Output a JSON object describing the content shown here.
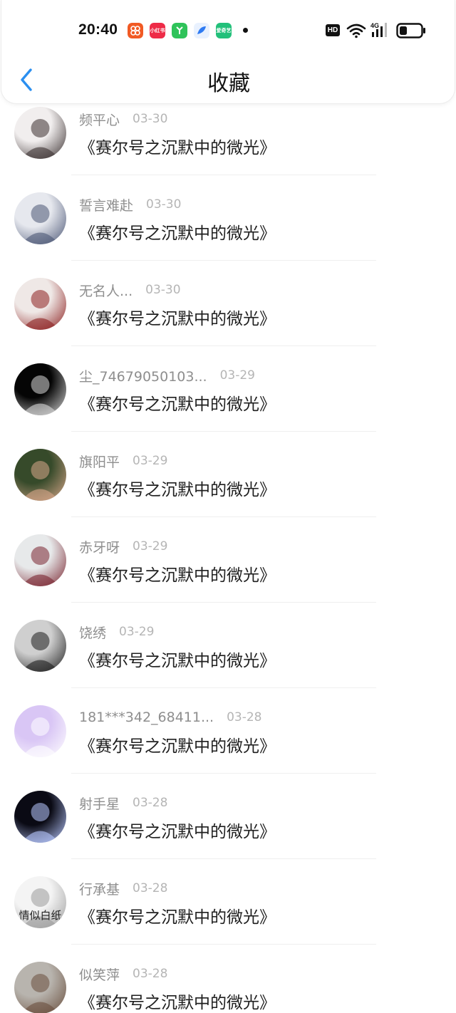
{
  "status_bar": {
    "time": "20:40",
    "apps": [
      {
        "icon": "app-orange-icon",
        "color": "#f15a24",
        "label": ""
      },
      {
        "icon": "xiaohongshu-icon",
        "color": "#ee2b47",
        "label": "小红书"
      },
      {
        "icon": "app-green-icon",
        "color": "#2fc35a",
        "label": ""
      },
      {
        "icon": "app-blue-icon",
        "color": "#2f7bf2",
        "label": ""
      },
      {
        "icon": "iqiyi-icon",
        "color": "#22c07a",
        "label": "爱奇艺"
      }
    ],
    "hd_label": "HD",
    "network_label": "4G",
    "battery_level": 0.35
  },
  "nav": {
    "back_icon": "chevron-left-icon",
    "title": "收藏",
    "accent_color": "#2a8ff0"
  },
  "items": [
    {
      "username": "频平心",
      "date": "03-30",
      "title": "《赛尔号之沉默中的微光》",
      "avatar_colors": [
        "#f1eeee",
        "#3a3030"
      ]
    },
    {
      "username": "誓言难赴",
      "date": "03-30",
      "title": "《赛尔号之沉默中的微光》",
      "avatar_colors": [
        "#e6e8ee",
        "#4b5675"
      ]
    },
    {
      "username": "无名人...",
      "date": "03-30",
      "title": "《赛尔号之沉默中的微光》",
      "avatar_colors": [
        "#efe8e6",
        "#8c1f1f"
      ]
    },
    {
      "username": "尘_74679050103...",
      "date": "03-29",
      "title": "《赛尔号之沉默中的微光》",
      "avatar_colors": [
        "#050505",
        "#d9d9d9"
      ]
    },
    {
      "username": "旗阳平",
      "date": "03-29",
      "title": "《赛尔号之沉默中的微光》",
      "avatar_colors": [
        "#364a2a",
        "#d8a78a"
      ]
    },
    {
      "username": "赤牙呀",
      "date": "03-29",
      "title": "《赛尔号之沉默中的微光》",
      "avatar_colors": [
        "#e7e9ea",
        "#7a2530"
      ]
    },
    {
      "username": "饶绣",
      "date": "03-29",
      "title": "《赛尔号之沉默中的微光》",
      "avatar_colors": [
        "#cfcfcf",
        "#1e1e1e"
      ]
    },
    {
      "username": "181***342_68411...",
      "date": "03-28",
      "title": "《赛尔号之沉默中的微光》",
      "avatar_colors": [
        "#d9c6f5",
        "#ffffff"
      ]
    },
    {
      "username": "射手星",
      "date": "03-28",
      "title": "《赛尔号之沉默中的微光》",
      "avatar_colors": [
        "#0a0a14",
        "#b8c8ff"
      ]
    },
    {
      "username": "行承基",
      "date": "03-28",
      "title": "《赛尔号之沉默中的微光》",
      "avatar_colors": [
        "#f4f4f4",
        "#9b9b9b"
      ],
      "avatar_text": "情似白纸"
    },
    {
      "username": "似笑萍",
      "date": "03-28",
      "title": "《赛尔号之沉默中的微光》",
      "avatar_colors": [
        "#b8b4ae",
        "#6a4f3e"
      ]
    }
  ]
}
